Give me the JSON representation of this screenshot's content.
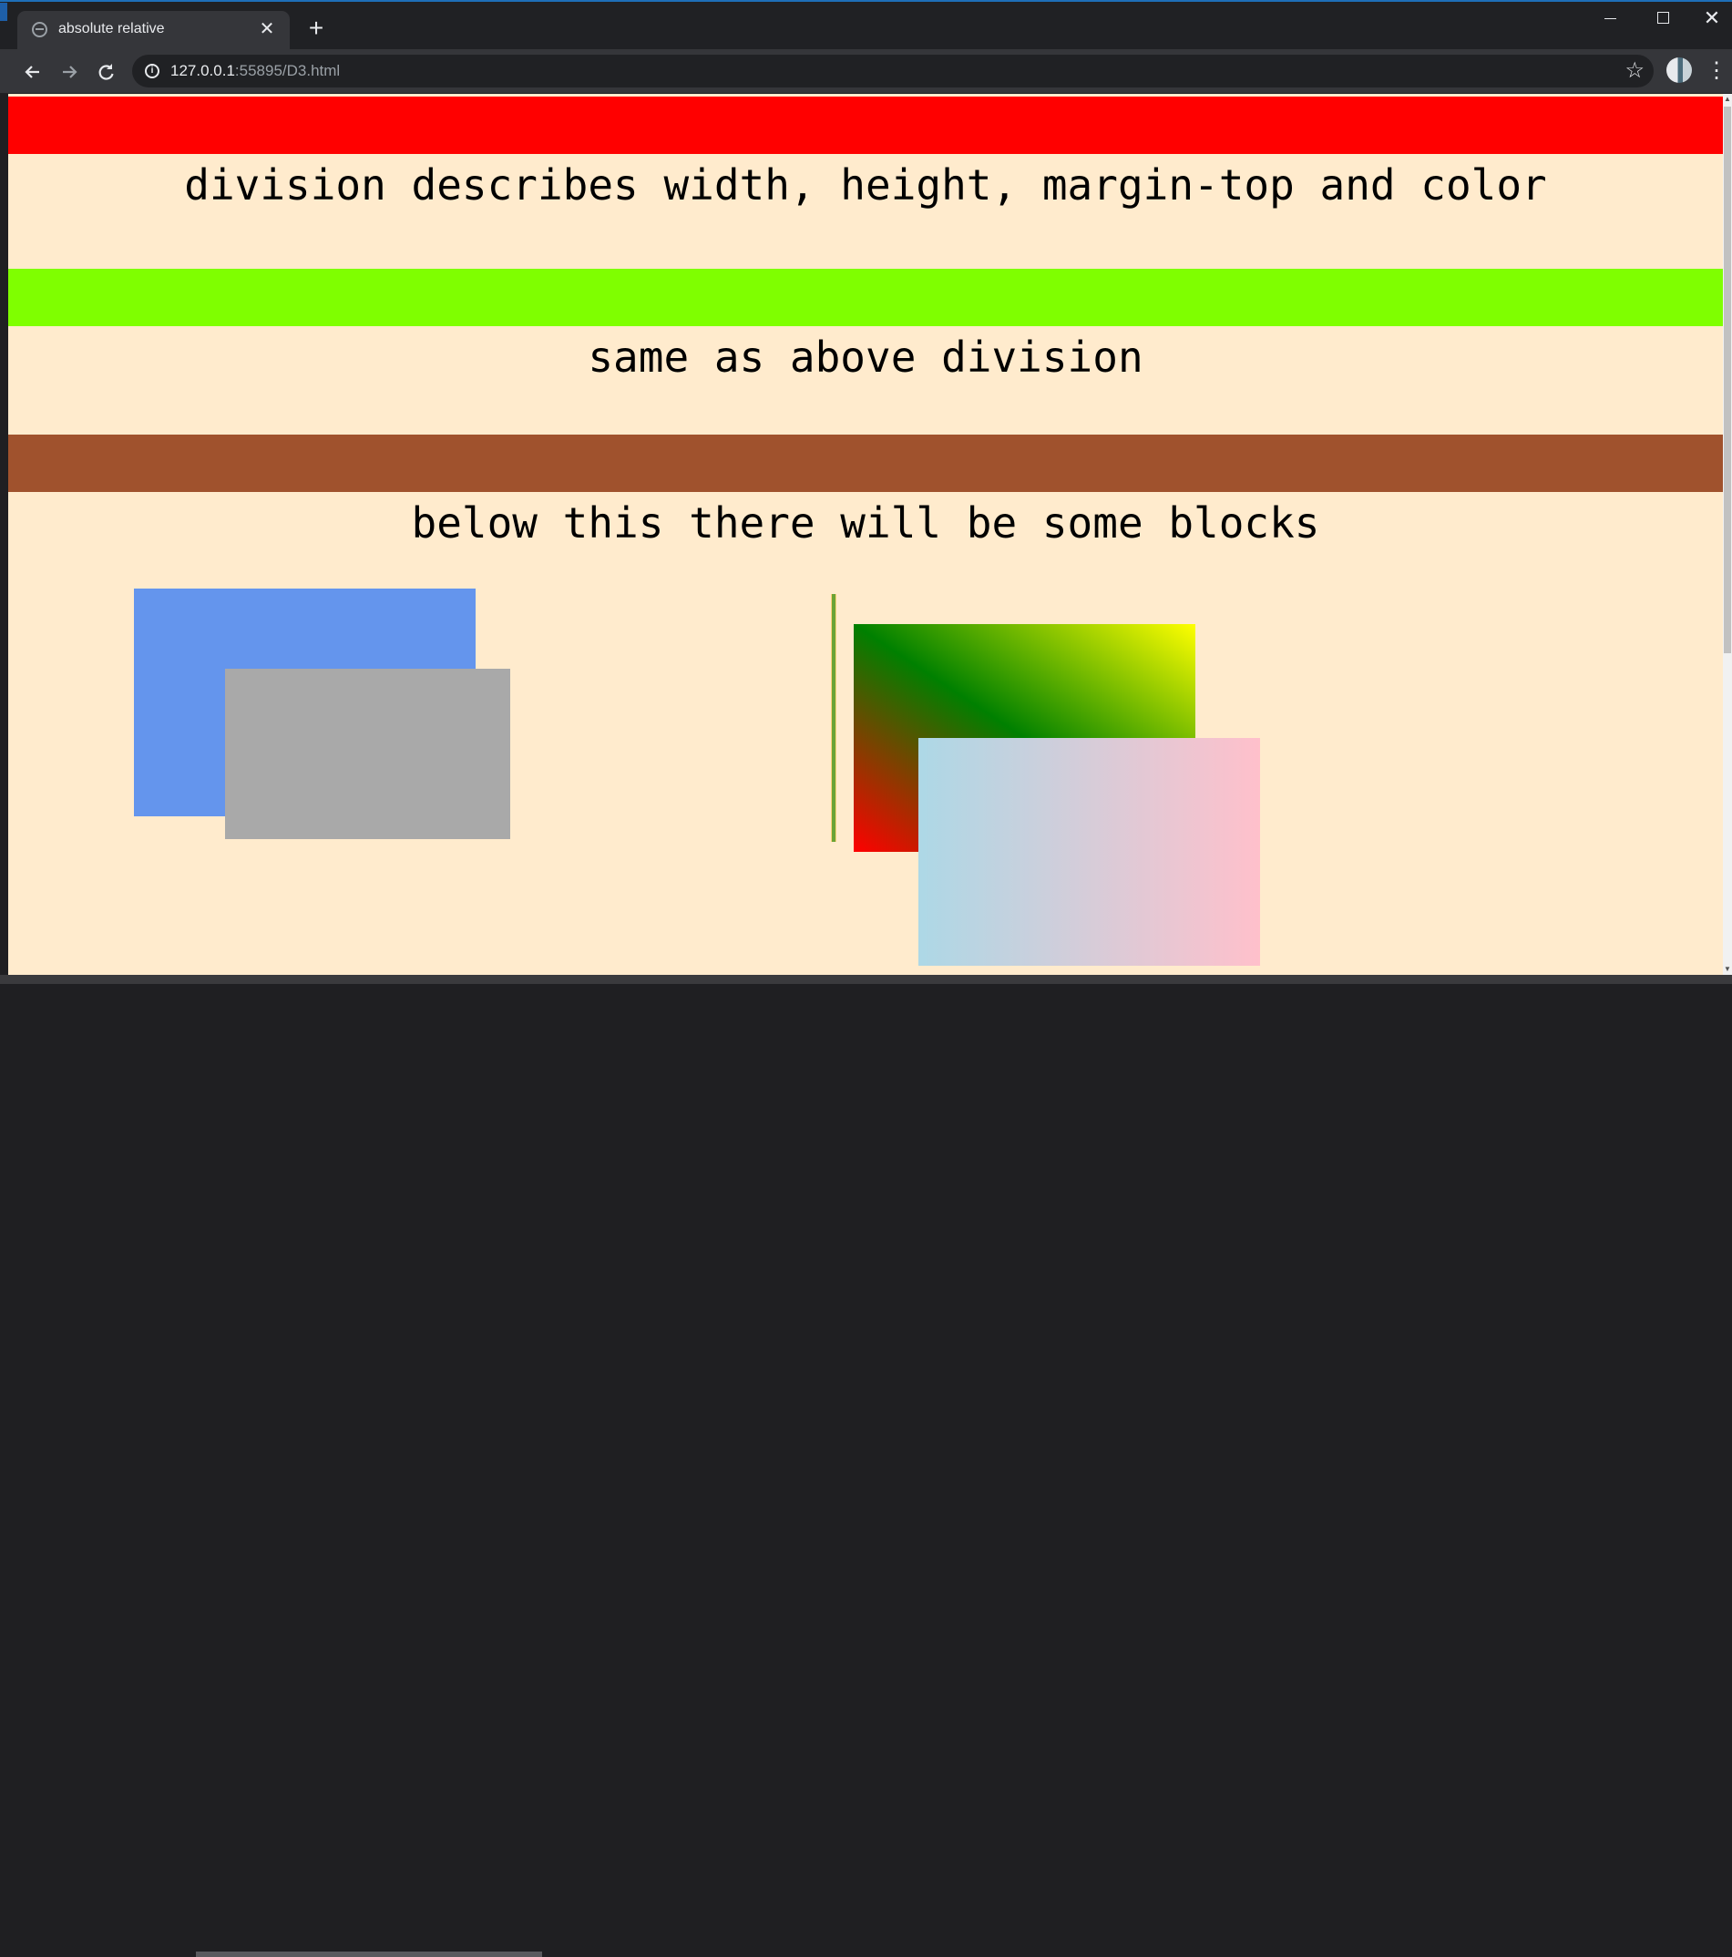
{
  "browser": {
    "tab_title": "absolute relative",
    "tab_close": "✕",
    "new_tab": "+",
    "url_host": "127.0.0.1",
    "url_rest": ":55895/D3.html",
    "window_controls": {
      "close": "✕"
    }
  },
  "page": {
    "background": "#ffebcd",
    "captions": [
      "division describes width, height, margin-top and color",
      "same as above division",
      "below this there will be some blocks"
    ],
    "bands": [
      {
        "color": "#ff0000"
      },
      {
        "color": "#7fff00"
      },
      {
        "color": "#a0522d"
      }
    ],
    "blocks": {
      "blue": "#6495ed",
      "gray": "#a9a9a9",
      "gradient": [
        "#ff0000",
        "#008000",
        "#ffff00"
      ],
      "pastel": [
        "#add8e6",
        "#ffc0cb"
      ]
    }
  }
}
